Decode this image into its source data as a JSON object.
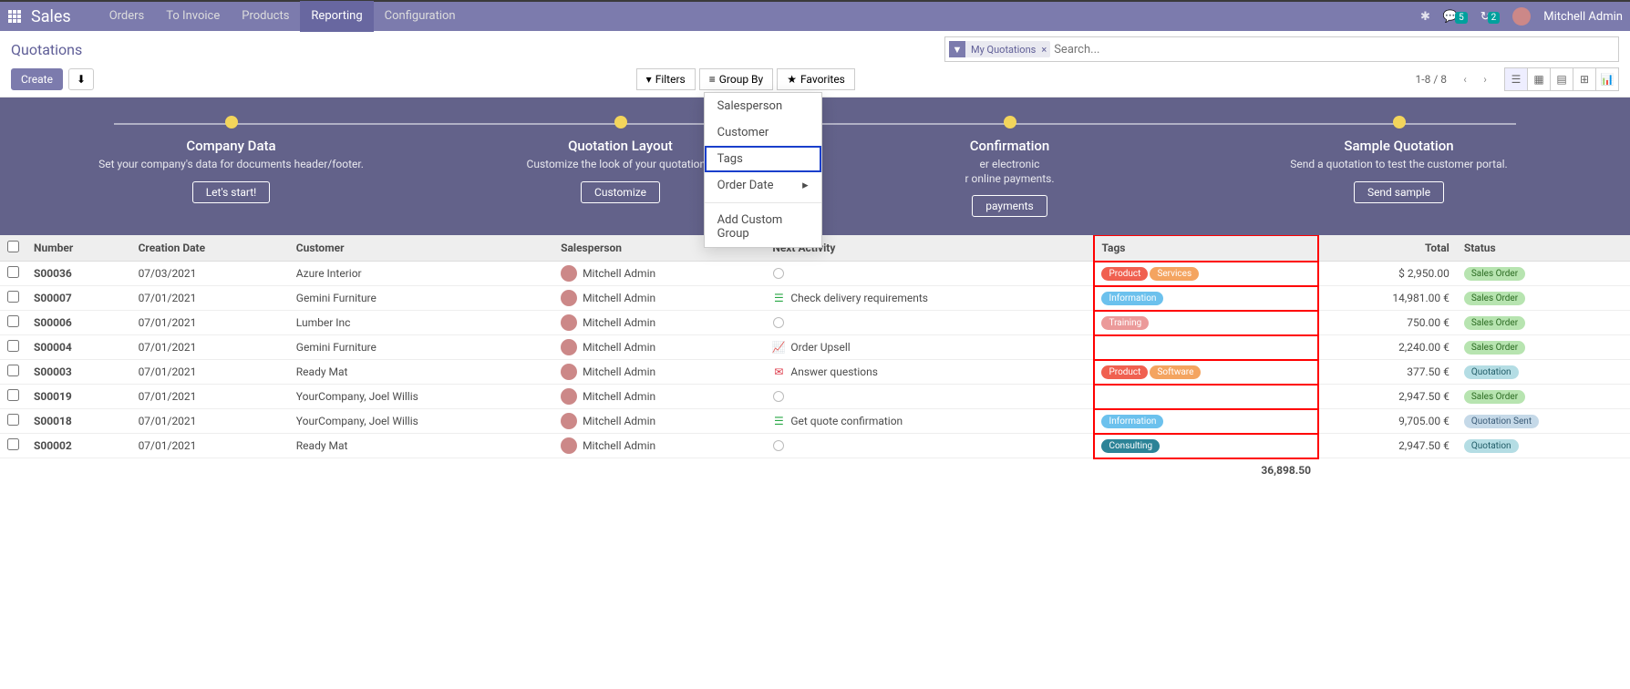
{
  "topnav": {
    "brand": "Sales",
    "menu": [
      "Orders",
      "To Invoice",
      "Products",
      "Reporting",
      "Configuration"
    ],
    "active": 3,
    "badges": {
      "msg": "5",
      "sys": "2"
    },
    "user": "Mitchell Admin"
  },
  "cp": {
    "breadcrumb": "Quotations",
    "create": "Create",
    "facet": "My Quotations",
    "search_ph": "Search...",
    "filters": "Filters",
    "groupby": "Group By",
    "favorites": "Favorites",
    "pager": "1-8 / 8"
  },
  "groupby_menu": {
    "items": [
      "Salesperson",
      "Customer",
      "Tags",
      "Order Date"
    ],
    "highlight": 2,
    "custom": "Add Custom Group"
  },
  "onboard": [
    {
      "title": "Company Data",
      "desc": "Set your company's data for documents header/footer.",
      "btn": "Let's start!"
    },
    {
      "title": "Quotation Layout",
      "desc": "Customize the look of your quotations.",
      "btn": "Customize"
    },
    {
      "title": "Confirmation",
      "desc": "er electronic\nr online payments.",
      "btn": "payments"
    },
    {
      "title": "Sample Quotation",
      "desc": "Send a quotation to test the customer portal.",
      "btn": "Send sample"
    }
  ],
  "columns": [
    "Number",
    "Creation Date",
    "Customer",
    "Salesperson",
    "Next Activity",
    "Tags",
    "Total",
    "Status"
  ],
  "rows": [
    {
      "num": "S00036",
      "date": "07/03/2021",
      "cust": "Azure Interior",
      "sp": "Mitchell Admin",
      "act": null,
      "act_ico": "clock",
      "tags": [
        {
          "t": "Product",
          "c": "c-red"
        },
        {
          "t": "Services",
          "c": "c-orange"
        }
      ],
      "total": "$ 2,950.00",
      "status": {
        "t": "Sales Order",
        "c": "s-sales"
      }
    },
    {
      "num": "S00007",
      "date": "07/01/2021",
      "cust": "Gemini Furniture",
      "sp": "Mitchell Admin",
      "act": "Check delivery requirements",
      "act_ico": "list-green",
      "tags": [
        {
          "t": "Information",
          "c": "c-lblue"
        }
      ],
      "total": "14,981.00 €",
      "status": {
        "t": "Sales Order",
        "c": "s-sales"
      }
    },
    {
      "num": "S00006",
      "date": "07/01/2021",
      "cust": "Lumber Inc",
      "sp": "Mitchell Admin",
      "act": null,
      "act_ico": "clock",
      "tags": [
        {
          "t": "Training",
          "c": "c-salmon"
        }
      ],
      "total": "750.00 €",
      "status": {
        "t": "Sales Order",
        "c": "s-sales"
      }
    },
    {
      "num": "S00004",
      "date": "07/01/2021",
      "cust": "Gemini Furniture",
      "sp": "Mitchell Admin",
      "act": "Order Upsell",
      "act_ico": "chart-green",
      "tags": [],
      "total": "2,240.00 €",
      "status": {
        "t": "Sales Order",
        "c": "s-sales"
      }
    },
    {
      "num": "S00003",
      "date": "07/01/2021",
      "cust": "Ready Mat",
      "sp": "Mitchell Admin",
      "act": "Answer questions",
      "act_ico": "mail-red",
      "tags": [
        {
          "t": "Product",
          "c": "c-red"
        },
        {
          "t": "Software",
          "c": "c-orange"
        }
      ],
      "total": "377.50 €",
      "status": {
        "t": "Quotation",
        "c": "s-quot"
      }
    },
    {
      "num": "S00019",
      "date": "07/01/2021",
      "cust": "YourCompany, Joel Willis",
      "sp": "Mitchell Admin",
      "act": null,
      "act_ico": "clock",
      "tags": [],
      "total": "2,947.50 €",
      "status": {
        "t": "Sales Order",
        "c": "s-sales"
      }
    },
    {
      "num": "S00018",
      "date": "07/01/2021",
      "cust": "YourCompany, Joel Willis",
      "sp": "Mitchell Admin",
      "act": "Get quote confirmation",
      "act_ico": "list-green",
      "tags": [
        {
          "t": "Information",
          "c": "c-lblue"
        }
      ],
      "total": "9,705.00 €",
      "status": {
        "t": "Quotation Sent",
        "c": "s-quotsent"
      }
    },
    {
      "num": "S00002",
      "date": "07/01/2021",
      "cust": "Ready Mat",
      "sp": "Mitchell Admin",
      "act": null,
      "act_ico": "clock",
      "tags": [
        {
          "t": "Consulting",
          "c": "c-teal"
        }
      ],
      "total": "2,947.50 €",
      "status": {
        "t": "Quotation",
        "c": "s-quot"
      }
    }
  ],
  "footer_total": "36,898.50"
}
